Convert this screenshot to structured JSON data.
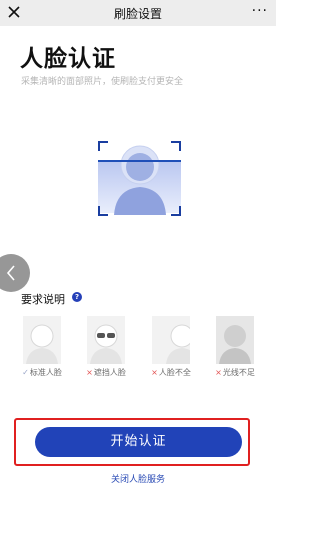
{
  "topbar": {
    "title": "刷脸设置",
    "close_icon": "close-icon",
    "more_label": "···"
  },
  "main": {
    "title": "人脸认证",
    "subtitle": "采集清晰的面部照片，使刷脸支付更安全"
  },
  "requirements": {
    "title": "要求说明",
    "help_label": "?",
    "examples": [
      {
        "mark": "✓",
        "label": "标准人脸",
        "status": "ok"
      },
      {
        "mark": "×",
        "label": "遮挡人脸",
        "status": "bad"
      },
      {
        "mark": "×",
        "label": "人脸不全",
        "status": "bad"
      },
      {
        "mark": "×",
        "label": "光线不足",
        "status": "bad"
      }
    ]
  },
  "actions": {
    "start_label": "开始认证",
    "close_service_label": "关闭人脸服务"
  },
  "colors": {
    "accent": "#2143b8",
    "highlight": "#e02020",
    "error": "#e25555"
  }
}
